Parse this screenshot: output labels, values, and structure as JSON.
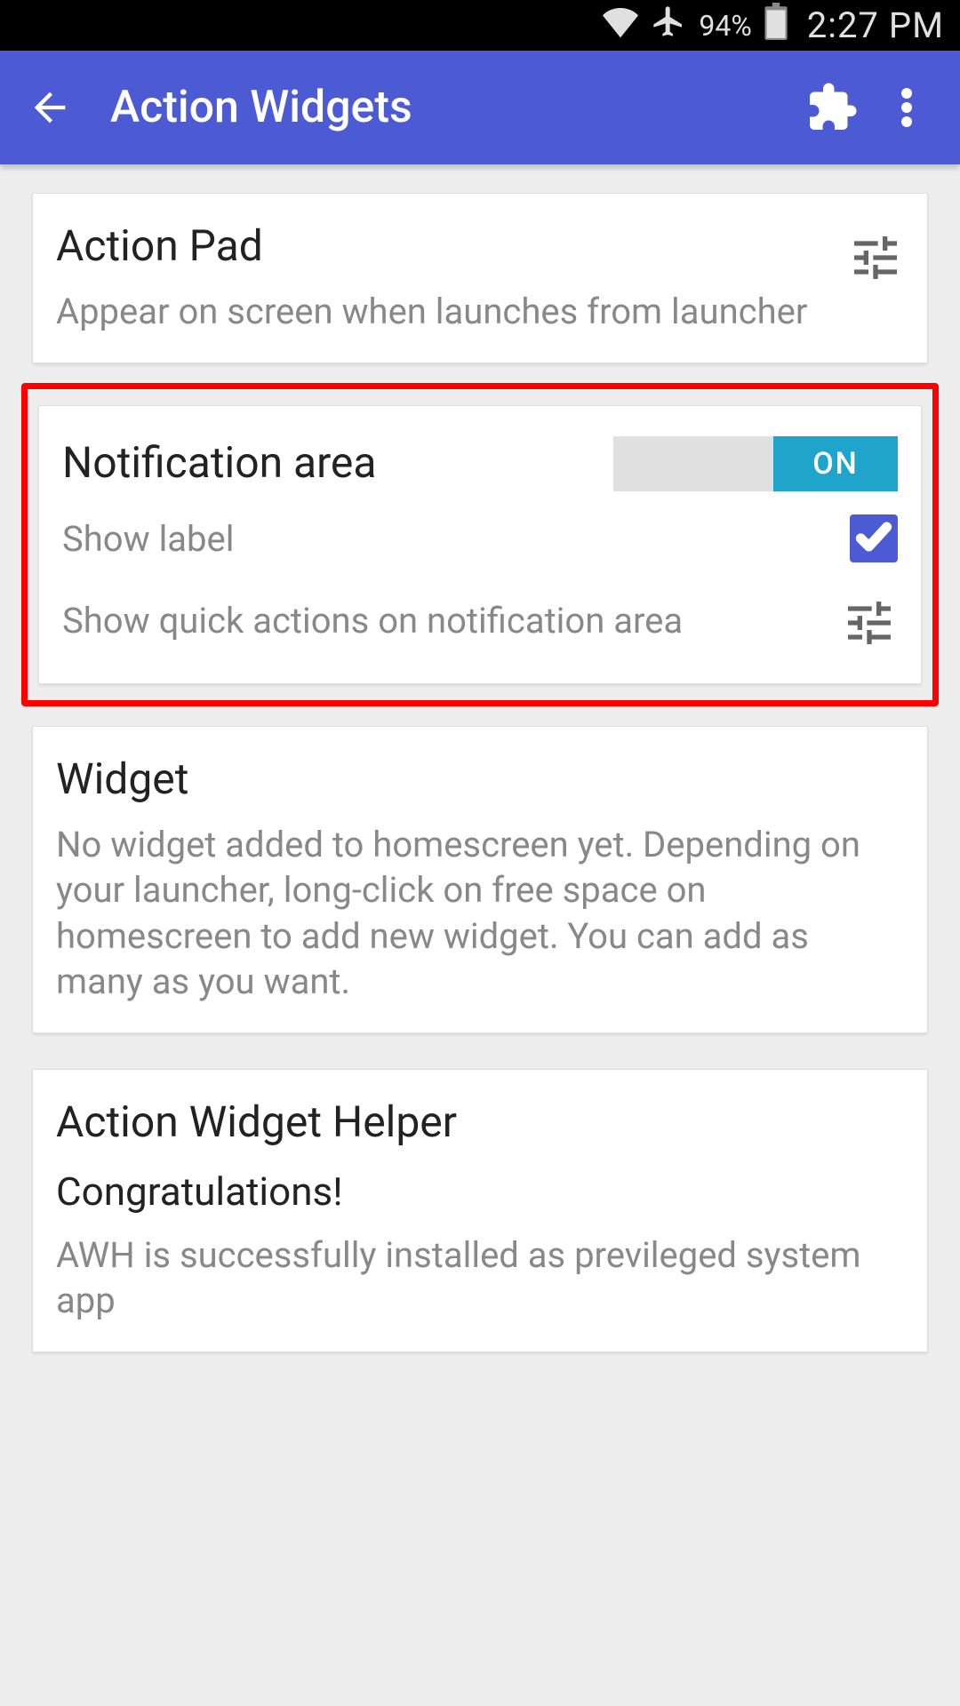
{
  "status": {
    "battery_pct": "94%",
    "time": "2:27 PM"
  },
  "appbar": {
    "title": "Action Widgets"
  },
  "cards": {
    "action_pad": {
      "title": "Action Pad",
      "desc": "Appear on screen when launches from launcher"
    },
    "notification": {
      "title": "Notification area",
      "toggle_label": "ON",
      "show_label": "Show label",
      "quick_actions": "Show quick actions on notification area"
    },
    "widget": {
      "title": "Widget",
      "desc": "No widget added to homescreen yet. Depending on your launcher, long-click on free space on homescreen to add new widget. You can add as many as you want."
    },
    "helper": {
      "title": "Action Widget Helper",
      "subtitle": "Congratulations!",
      "desc": "AWH is successfully installed as previleged system app"
    }
  }
}
